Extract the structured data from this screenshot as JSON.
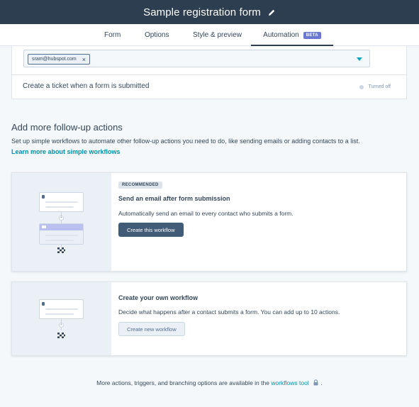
{
  "header": {
    "title": "Sample registration form",
    "edit_icon": "pencil-icon"
  },
  "tabs": [
    {
      "label": "Form",
      "active": false
    },
    {
      "label": "Options",
      "active": false
    },
    {
      "label": "Style & preview",
      "active": false
    },
    {
      "label": "Automation",
      "active": true,
      "badge": "BETA"
    }
  ],
  "notifications": {
    "recipient_chip": "sram@hubspot.com",
    "chip_remove": "×"
  },
  "ticket": {
    "label": "Create a ticket when a form is submitted",
    "status": "Turned off"
  },
  "followup": {
    "title": "Add more follow-up actions",
    "description": "Set up simple workflows to automate other follow-up actions you need to do, like sending emails or adding contacts to a list.",
    "link": "Learn more about simple workflows"
  },
  "workflow_cards": [
    {
      "badge": "RECOMMENDED",
      "title": "Send an email after form submission",
      "description": "Automatically send an email to every contact who submits a form.",
      "button": "Create this workflow"
    },
    {
      "title": "Create your own workflow",
      "description": "Decide what happens after a contact submits a form. You can add up to 10 actions.",
      "button": "Create new workflow"
    }
  ],
  "footer": {
    "text_before": "More actions, triggers, and branching options are available in the",
    "link": "workflows tool",
    "text_after": "."
  },
  "colors": {
    "header_bg": "#2d3e50",
    "link": "#0091ae",
    "beta_badge": "#6a78d1",
    "primary_button": "#425b76"
  }
}
